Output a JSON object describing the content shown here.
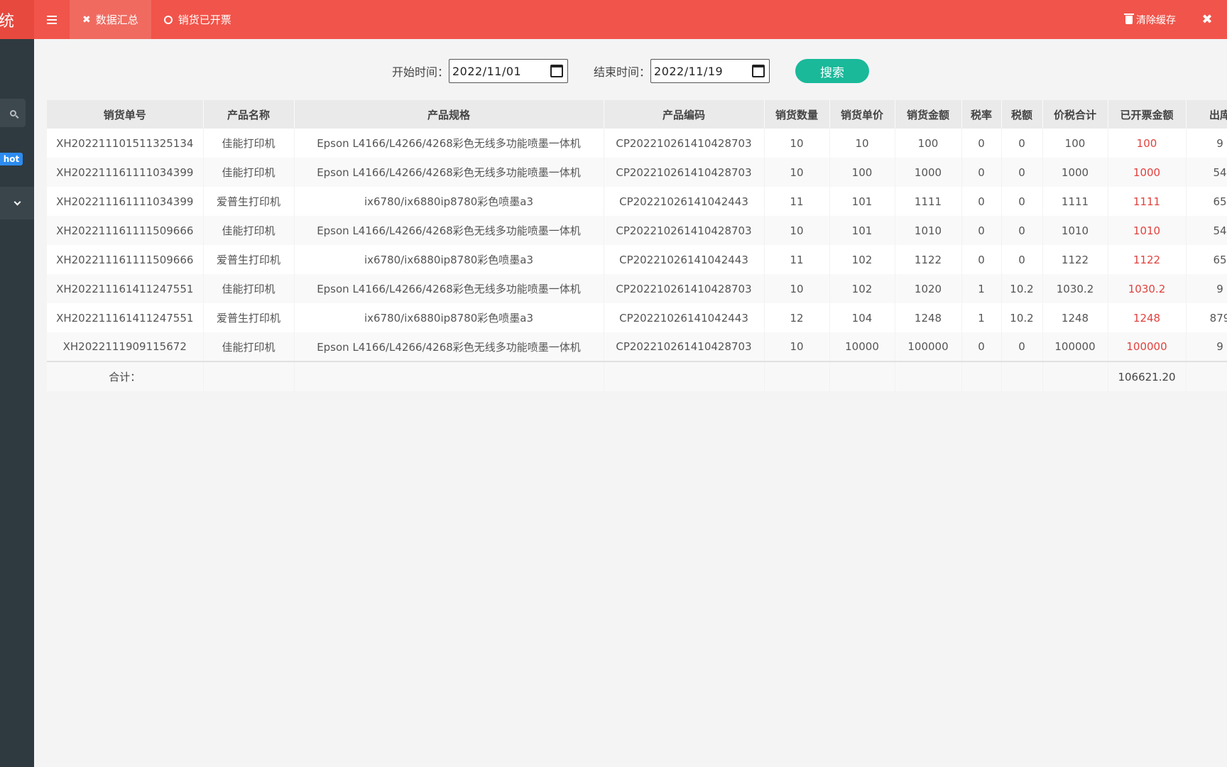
{
  "brand": {
    "text": "统"
  },
  "top_tabs": [
    {
      "label": "数据汇总",
      "icon": "close-x-icon"
    },
    {
      "label": "销货已开票",
      "icon": "circle-icon"
    }
  ],
  "top_right": {
    "clear_cache_label": "清除缓存"
  },
  "sidebar": {
    "hot_badge": "hot"
  },
  "filters": {
    "start_label": "开始时间：",
    "start_value": "2022/11/01",
    "end_label": "结束时间：",
    "end_value": "2022/11/19",
    "search_label": "搜索"
  },
  "table": {
    "headers": [
      "销货单号",
      "产品名称",
      "产品规格",
      "产品编码",
      "销货数量",
      "销货单价",
      "销货金额",
      "税率",
      "税额",
      "价税合计",
      "已开票金额",
      "出库"
    ],
    "rows": [
      [
        "XH202211101511325134",
        "佳能打印机",
        "Epson L4166/L4266/4268彩色无线多功能喷墨一体机",
        "CP202210261410428703",
        "10",
        "10",
        "100",
        "0",
        "0",
        "100",
        "100",
        "9"
      ],
      [
        "XH202211161111034399",
        "佳能打印机",
        "Epson L4166/L4266/4268彩色无线多功能喷墨一体机",
        "CP202210261410428703",
        "10",
        "100",
        "1000",
        "0",
        "0",
        "1000",
        "1000",
        "54"
      ],
      [
        "XH202211161111034399",
        "爱普生打印机",
        "ix6780/ix6880ip8780彩色喷墨a3",
        "CP2022102614104244​3",
        "11",
        "101",
        "1111",
        "0",
        "0",
        "1111",
        "1111",
        "65"
      ],
      [
        "XH202211161111509666",
        "佳能打印机",
        "Epson L4166/L4266/4268彩色无线多功能喷墨一体机",
        "CP202210261410428703",
        "10",
        "101",
        "1010",
        "0",
        "0",
        "1010",
        "1010",
        "54"
      ],
      [
        "XH202211161111509666",
        "爱普生打印机",
        "ix6780/ix6880ip8780彩色喷墨a3",
        "CP2022102614104244​3",
        "11",
        "102",
        "1122",
        "0",
        "0",
        "1122",
        "1122",
        "65"
      ],
      [
        "XH202211161411247551",
        "佳能打印机",
        "Epson L4166/L4266/4268彩色无线多功能喷墨一体机",
        "CP202210261410428703",
        "10",
        "102",
        "1020",
        "1",
        "10.2",
        "1030.2",
        "1030.2",
        "9"
      ],
      [
        "XH202211161411247551",
        "爱普生打印机",
        "ix6780/ix6880ip8780彩色喷墨a3",
        "CP2022102614104244​3",
        "12",
        "104",
        "1248",
        "1",
        "10.2",
        "1248",
        "1248",
        "879"
      ],
      [
        "XH2022111909115672",
        "佳能打印机",
        "Epson L4166/L4266/4268彩色无线多功能喷墨一体机",
        "CP202210261410428703",
        "10",
        "10000",
        "100000",
        "0",
        "0",
        "100000",
        "100000",
        "9"
      ]
    ],
    "total_label": "合计：",
    "total_invoiced": "106621.20"
  },
  "colors": {
    "topbar": "#f1544a",
    "accent_green": "#19b99a",
    "invoiced_red": "#e2413d",
    "sidebar": "#2f3a40"
  }
}
